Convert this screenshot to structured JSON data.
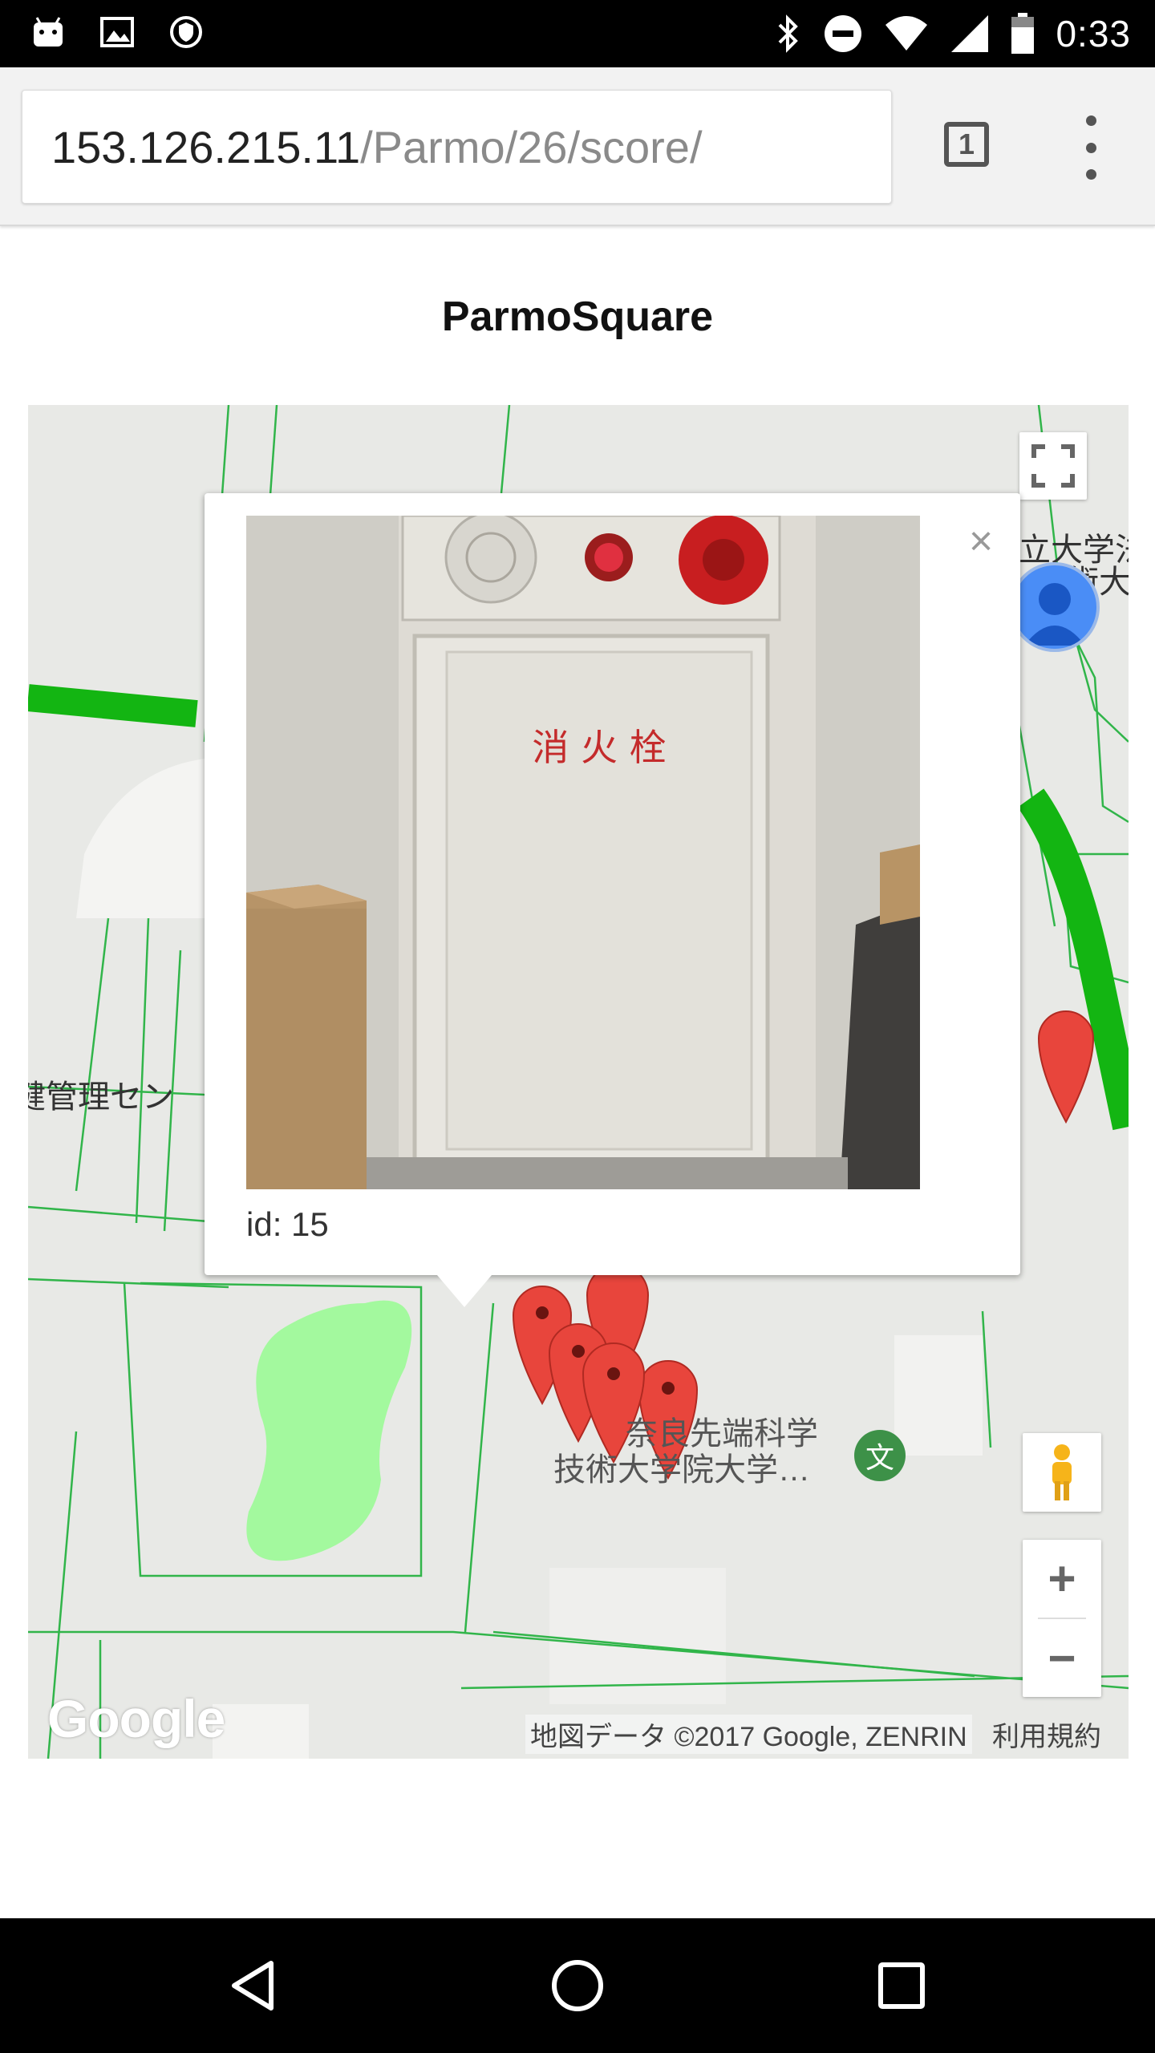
{
  "status_bar": {
    "time": "0:33",
    "icons": [
      "android-icon",
      "image-icon",
      "shield-icon",
      "bluetooth-icon",
      "do-not-disturb-icon",
      "wifi-icon",
      "signal-icon",
      "battery-icon"
    ]
  },
  "browser": {
    "url_host": "153.126.215.11",
    "url_path": "/Parmo/26/score/",
    "tab_count": "1"
  },
  "page": {
    "title": "ParmoSquare"
  },
  "map": {
    "labels": {
      "university_fragment_top": "立大学法",
      "university_fragment_bottom": "術大",
      "health_center": "健管理セン",
      "naist_line1": "奈良先端科学",
      "naist_line2": "技術大学院大学…",
      "school_glyph": "文"
    },
    "google_logo": "Google",
    "copyright": "地図データ ©2017 Google, ZENRIN",
    "terms": "利用規約",
    "zoom_in": "+",
    "zoom_out": "−",
    "markers_color": "#e8453c",
    "info_window": {
      "id_text": "id: 15",
      "close": "×",
      "photo_sign": "消 火 栓"
    }
  }
}
